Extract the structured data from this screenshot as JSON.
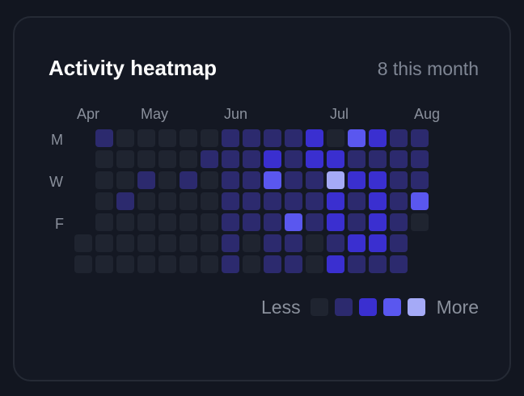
{
  "card": {
    "title": "Activity heatmap",
    "summary": "8 this month"
  },
  "months": [
    "Apr",
    "May",
    "Jun",
    "Jul",
    "Aug"
  ],
  "weekdays": [
    "M",
    "W",
    "F"
  ],
  "legend": {
    "less_label": "Less",
    "more_label": "More",
    "levels": [
      0,
      1,
      2,
      3,
      4
    ]
  },
  "colors": {
    "level_0": "#1f2430",
    "level_1": "#2c2a6e",
    "level_2": "#3a2fd0",
    "level_3": "#5a57ef",
    "level_4": "#a5aaf7"
  },
  "chart_data": {
    "type": "heatmap",
    "rows": 7,
    "columns": 17,
    "grid": [
      [
        null,
        1,
        0,
        0,
        0,
        0,
        0,
        1,
        1,
        1,
        1,
        2,
        0,
        3,
        2,
        1,
        1
      ],
      [
        null,
        0,
        0,
        0,
        0,
        0,
        1,
        1,
        1,
        2,
        1,
        2,
        2,
        1,
        1,
        1,
        1
      ],
      [
        null,
        0,
        0,
        1,
        0,
        1,
        0,
        1,
        1,
        3,
        1,
        1,
        4,
        2,
        2,
        1,
        1
      ],
      [
        null,
        0,
        1,
        0,
        0,
        0,
        0,
        1,
        1,
        1,
        1,
        1,
        2,
        1,
        2,
        1,
        3
      ],
      [
        null,
        0,
        0,
        0,
        0,
        0,
        0,
        1,
        1,
        1,
        3,
        1,
        2,
        1,
        2,
        1,
        0
      ],
      [
        0,
        0,
        0,
        0,
        0,
        0,
        0,
        1,
        0,
        1,
        1,
        0,
        1,
        2,
        2,
        1,
        null
      ],
      [
        0,
        0,
        0,
        0,
        0,
        0,
        0,
        1,
        0,
        1,
        1,
        0,
        2,
        1,
        1,
        1,
        null
      ]
    ]
  }
}
